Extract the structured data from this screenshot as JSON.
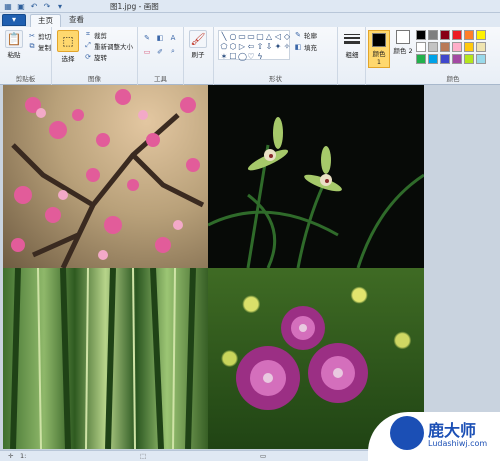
{
  "window": {
    "title": "图1.jpg - 画图"
  },
  "quick_access": [
    "save-icon",
    "undo-icon",
    "redo-icon"
  ],
  "tabs": {
    "file": "▾",
    "home": "主页",
    "view": "查看"
  },
  "clipboard": {
    "paste": "粘贴",
    "cut": "剪切",
    "copy": "复制",
    "label": "剪贴板"
  },
  "image": {
    "select": "选择",
    "crop": "裁剪",
    "resize": "重新调整大小",
    "rotate": "旋转",
    "label": "图像"
  },
  "tools": {
    "label": "工具",
    "pencil": "✎",
    "fill": "◧",
    "text": "A",
    "eraser": "▭",
    "picker": "✐",
    "zoom": "⌕"
  },
  "brushes": {
    "label": "刷子"
  },
  "shapes": {
    "label": "形状",
    "outline": "轮廓",
    "fill": "填充",
    "items": [
      "╲",
      "○",
      "▭",
      "▭",
      "▢",
      "△",
      "◁",
      "◇",
      "⬠",
      "⬡",
      "▷",
      "⇦",
      "⇧",
      "⇩",
      "✦",
      "✧",
      "✶",
      "☐",
      "◯",
      "♡",
      "ϟ"
    ]
  },
  "size": {
    "label": "粗细"
  },
  "colors": {
    "label": "颜色",
    "color1": "颜色 1",
    "color2": "颜色 2",
    "color1_value": "#000000",
    "color2_value": "#ffffff",
    "palette": [
      "#000000",
      "#7f7f7f",
      "#880015",
      "#ed1c24",
      "#ff7f27",
      "#fff200",
      "#ffffff",
      "#c3c3c3",
      "#b97a57",
      "#ffaec9",
      "#ffc90e",
      "#efe4b0",
      "#22b14c",
      "#00a2e8",
      "#3f48cc",
      "#a349a4",
      "#b5e61d",
      "#99d9ea"
    ]
  },
  "status": {
    "pos": "1:",
    "selection": "",
    "size": "",
    "zoom": ""
  },
  "watermark": {
    "main": "鹿大师",
    "sub": "Ludashiwj.com"
  }
}
